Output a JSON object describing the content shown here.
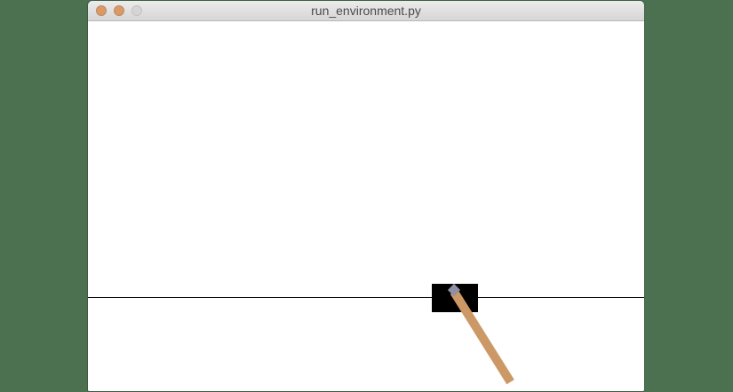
{
  "window": {
    "title": "run_environment.py"
  },
  "controls": {
    "close_icon": "traffic-light-close",
    "minimize_icon": "traffic-light-minimize",
    "zoom_icon": "traffic-light-zoom"
  },
  "colors": {
    "desktop_background": "#4b7151",
    "window_background": "#ffffff",
    "track": "#000000",
    "cart": "#000000",
    "pole": "#cc9966",
    "axle": "#8f8fa5",
    "close_button": "#d99a69",
    "minimize_button": "#d99a69",
    "zoom_button": "#d5d5d5"
  }
}
